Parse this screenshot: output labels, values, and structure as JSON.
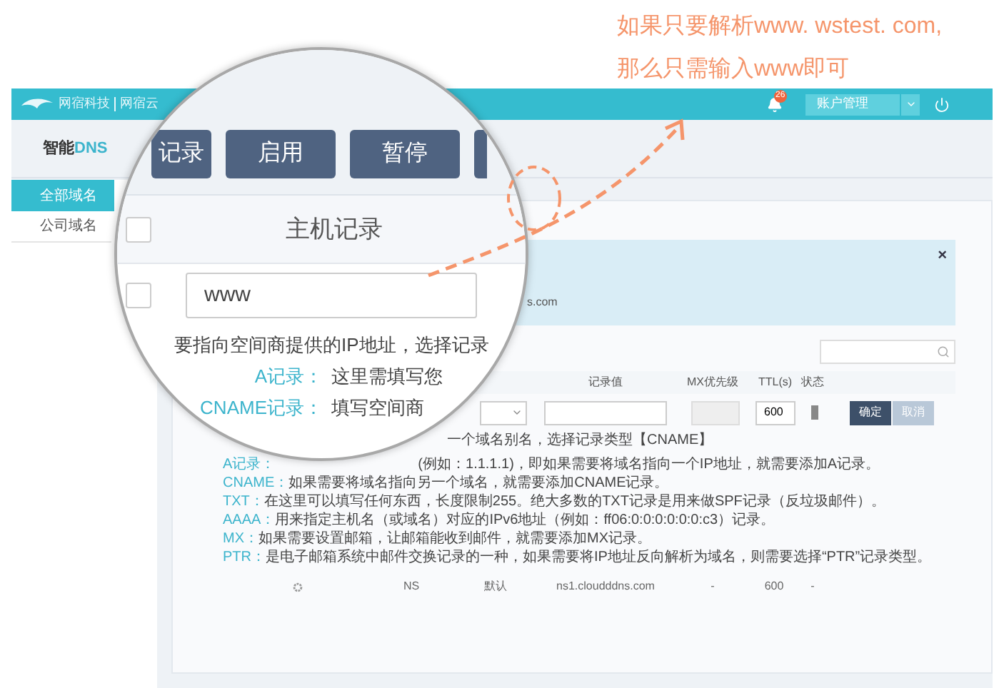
{
  "annotation": {
    "lines": [
      "如果只要解析www. wstest. com,",
      "那么只需输入www即可"
    ]
  },
  "header": {
    "brand": "网宿科技",
    "product": "网宿云",
    "notification_count": "26",
    "account_menu": "账户管理"
  },
  "app_logo": {
    "prefix": "智能",
    "suffix": "DNS"
  },
  "sidebar": {
    "items": [
      {
        "label": "全部域名",
        "selected": true
      },
      {
        "label": "公司域名",
        "selected": false
      }
    ]
  },
  "magnifier": {
    "checkboxes": [
      {
        "checked": false
      },
      {
        "checked": false
      }
    ],
    "toolbar_buttons": [
      "记录",
      "启用",
      "暂停"
    ],
    "column_header": "主机记录",
    "host_value": "www",
    "hint": "要指向空间商提供的IP地址，选择记录",
    "record_types": [
      {
        "label": "A记录：",
        "text": "这里需填写您"
      },
      {
        "label": "CNAME记录：",
        "text": "填写空间商"
      }
    ]
  },
  "info_box": {
    "text": "s.com",
    "close": "×"
  },
  "table": {
    "columns": [
      "",
      "",
      "记录值",
      "MX优先级",
      "TTL(s)",
      "状态"
    ],
    "edit_row": {
      "ttl": "600",
      "confirm": "确定",
      "cancel": "取消"
    },
    "help_tail": "一个域名别名，选择记录类型【CNAME】",
    "help": [
      {
        "label": "A记录：",
        "text": "(例如：1.1.1.1)，即如果需要将域名指向一个IP地址，就需要添加A记录。"
      },
      {
        "label": "CNAME：",
        "text": "如果需要将域名指向另一个域名，就需要添加CNAME记录。"
      },
      {
        "label": "TXT：",
        "text": "在这里可以填写任何东西，长度限制255。绝大多数的TXT记录是用来做SPF记录（反垃圾邮件）。"
      },
      {
        "label": "AAAA：",
        "text": "用来指定主机名（或域名）对应的IPv6地址（例如：ff06:0:0:0:0:0:0:c3）记录。"
      },
      {
        "label": "MX：",
        "text": "如果需要设置邮箱，让邮箱能收到邮件，就需要添加MX记录。"
      },
      {
        "label": "PTR：",
        "text": "是电子邮箱系统中邮件交换记录的一种，如果需要将IP地址反向解析为域名，则需要选择“PTR”记录类型。"
      }
    ],
    "rows": [
      {
        "cells": [
          "NS",
          "默认",
          "ns1.cloudddns.com",
          "-",
          "600",
          "-"
        ]
      }
    ]
  }
}
